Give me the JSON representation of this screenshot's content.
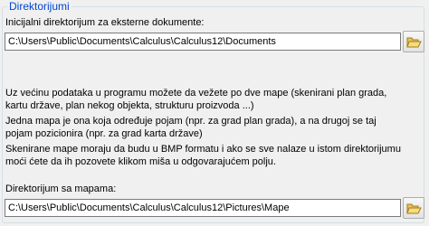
{
  "group": {
    "title": "Direktorijumi"
  },
  "external_docs": {
    "label": "Inicijalni direktorijum za eksterne dokumente:",
    "value": "C:\\Users\\Public\\Documents\\Calculus\\Calculus12\\Documents"
  },
  "info": {
    "para1_line1": "Uz većinu podataka u programu možete da vežete po dve mape (skenirani plan grada,",
    "para1_line2": "kartu države, plan nekog objekta, strukturu proizvoda ...)",
    "para2_line1": "Jedna mapa je ona koja određuje pojam (npr. za grad plan grada), a na drugoj se taj",
    "para2_line2": "pojam pozicionira (npr. za grad karta države)",
    "para3_line1": "Skenirane mape moraju da budu u BMP formatu i ako se sve nalaze u istom direktorijumu",
    "para3_line2": "moći ćete da ih pozovete klikom miša u odgovarajućem polju."
  },
  "maps_dir": {
    "label": "Direktorijum sa mapama:",
    "value": "C:\\Users\\Public\\Documents\\Calculus\\Calculus12\\Pictures\\Mape"
  },
  "icons": {
    "browse": "folder-open-icon"
  }
}
